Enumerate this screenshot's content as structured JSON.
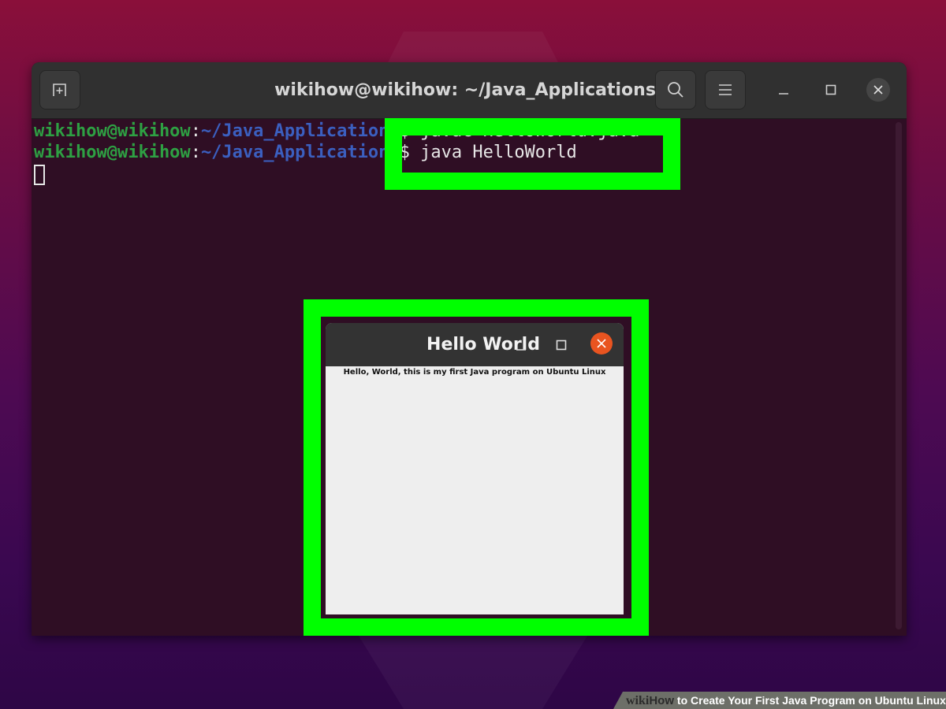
{
  "terminal": {
    "title": "wikihow@wikihow: ~/Java_Applications",
    "lines": [
      {
        "user": "wikihow@wikihow",
        "sep": ":",
        "path": "~/Java_Applications",
        "prompt": "$ ",
        "command": "javac HelloWorld.java"
      },
      {
        "user": "wikihow@wikihow",
        "sep": ":",
        "path": "~/Java_Applications",
        "prompt": "$ ",
        "command": "java HelloWorld"
      }
    ],
    "icons": {
      "new_tab": "new-tab-icon",
      "search": "search-icon",
      "menu": "hamburger-menu-icon",
      "minimize": "minimize-icon",
      "maximize": "maximize-icon",
      "close": "close-icon"
    }
  },
  "hello_window": {
    "title": "Hello World",
    "label": "Hello, World, this is my first Java  program on Ubuntu Linux",
    "close_color": "#e95420"
  },
  "highlight_color": "#00ff00",
  "watermark": {
    "wiki": "wiki",
    "how": "How",
    "caption": " to Create Your First Java Program on Ubuntu Linux"
  }
}
